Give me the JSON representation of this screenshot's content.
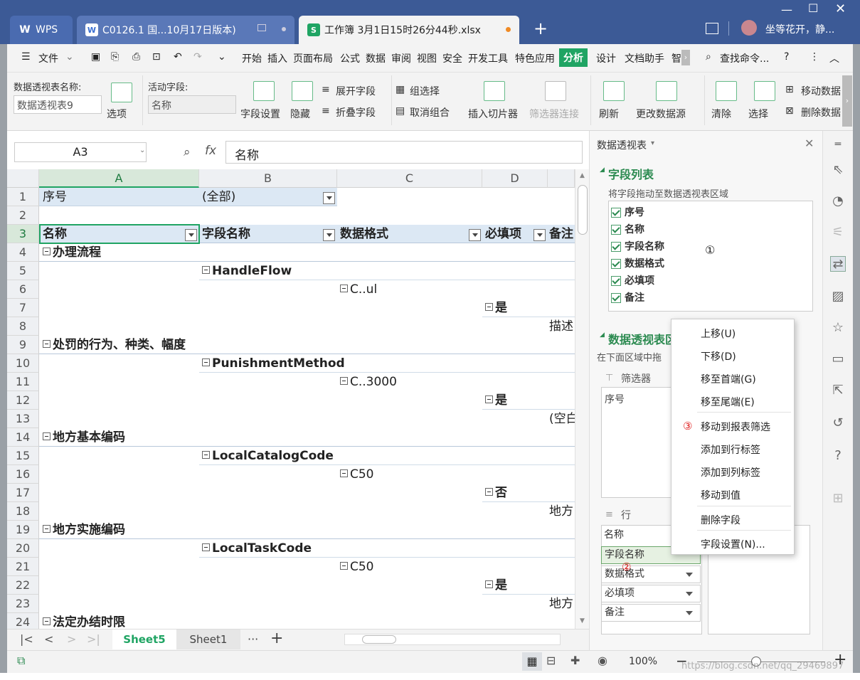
{
  "tabs": {
    "wps": "WPS",
    "doc": "C0126.1 国...10月17日版本)",
    "sheet": "工作簿 3月1日15时26分44秒.xlsx",
    "user": "坐等花开，静..."
  },
  "menu": {
    "file": "文件",
    "items": [
      "开始",
      "插入",
      "页面布局",
      "公式",
      "数据",
      "审阅",
      "视图",
      "安全",
      "开发工具",
      "特色应用",
      "分析",
      "设计",
      "文档助手",
      "智"
    ],
    "search": "查找命令..."
  },
  "ribbon": {
    "pt_name_label": "数据透视表名称:",
    "pt_name_value": "数据透视表9",
    "options": "选项",
    "active_field_label": "活动字段:",
    "active_field_value": "名称",
    "field_settings": "字段设置",
    "hide": "隐藏",
    "expand": "展开字段",
    "collapse": "折叠字段",
    "group_select": "组选择",
    "ungroup": "取消组合",
    "insert_slicer": "插入切片器",
    "filter_conn": "筛选器连接",
    "refresh": "刷新",
    "change_source": "更改数据源",
    "clear": "清除",
    "select": "选择",
    "move_pt": "移动数据",
    "delete_pt": "删除数据"
  },
  "formula": {
    "cell_ref": "A3",
    "fx": "fx",
    "value": "名称"
  },
  "columns": [
    "A",
    "B",
    "C",
    "D"
  ],
  "rows": [
    "1",
    "2",
    "3",
    "4",
    "5",
    "6",
    "7",
    "8",
    "9",
    "10",
    "11",
    "12",
    "13",
    "14",
    "15",
    "16",
    "17",
    "18",
    "19",
    "20",
    "21",
    "22",
    "23",
    "24"
  ],
  "cells": {
    "r1a": "序号",
    "r1b": "(全部)",
    "r3a": "名称",
    "r3b": "字段名称",
    "r3c": "数据格式",
    "r3d": "必填项",
    "r3e": "备注",
    "r4a": "办理流程",
    "r5b": "HandleFlow",
    "r6c": "C..ul",
    "r7d": "是",
    "r8e": "描述",
    "r9a": "处罚的行为、种类、幅度",
    "r10b": "PunishmentMethod",
    "r11c": "C..3000",
    "r12d": "是",
    "r13e": "(空白",
    "r14a": "地方基本编码",
    "r15b": "LocalCatalogCode",
    "r16c": "C50",
    "r17d": "否",
    "r18e": "地方",
    "r19a": "地方实施编码",
    "r20b": "LocalTaskCode",
    "r21c": "C50",
    "r22d": "是",
    "r23e": "地方",
    "r24a": "法定办结时限"
  },
  "sheet_tabs": [
    "Sheet5",
    "Sheet1"
  ],
  "panel": {
    "title": "数据透视表",
    "field_list": "字段列表",
    "hint": "将字段拖动至数据透视表区域",
    "fields": [
      "序号",
      "名称",
      "字段名称",
      "数据格式",
      "必填项",
      "备注"
    ],
    "marker1": "①",
    "areas_title": "数据透视表区",
    "areas_hint": "在下面区域中拖",
    "filter_label": "筛选器",
    "filter_item": "序号",
    "rows_label": "行",
    "row_items": [
      "名称",
      "字段名称",
      "数据格式",
      "必填项",
      "备注"
    ],
    "marker2": "②"
  },
  "context_menu": {
    "items": [
      "上移(U)",
      "下移(D)",
      "移至首端(G)",
      "移至尾端(E)",
      "移动到报表筛选",
      "添加到行标签",
      "添加到列标签",
      "移动到值",
      "删除字段",
      "字段设置(N)..."
    ],
    "marker3": "③"
  },
  "status": {
    "zoom": "100%",
    "watermark": "https://blog.csdn.net/qq_29469897"
  }
}
